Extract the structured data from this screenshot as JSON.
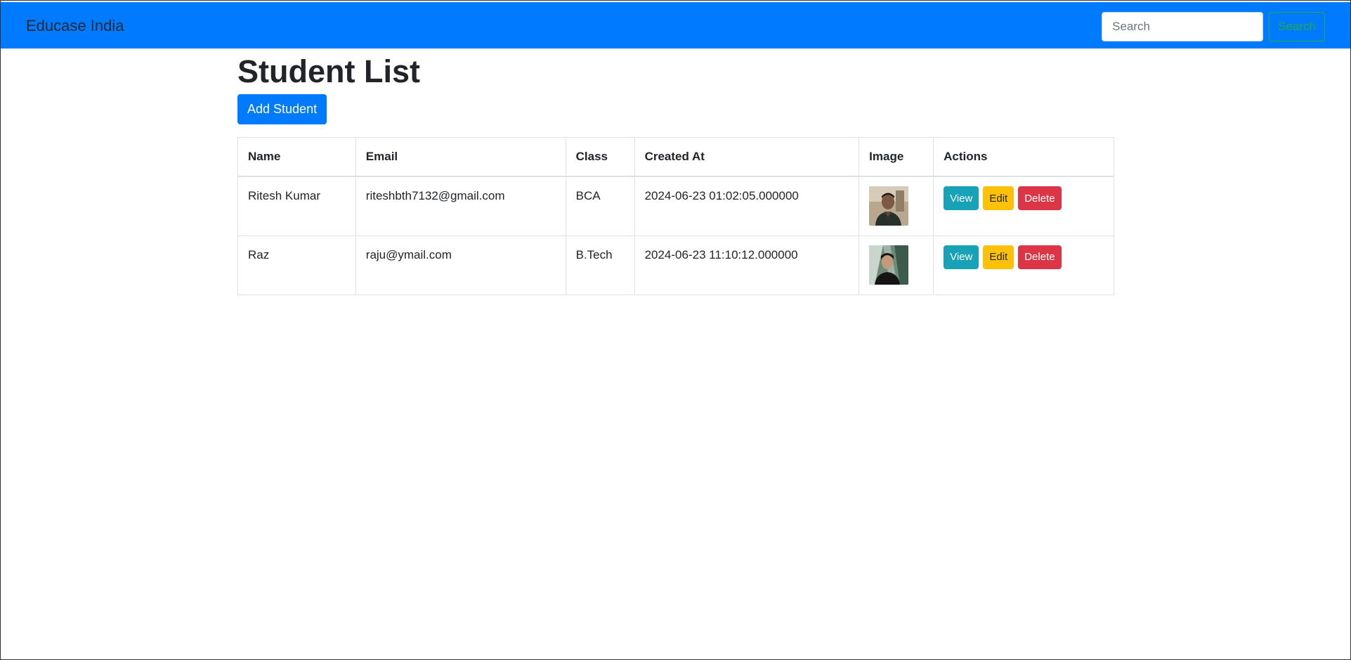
{
  "navbar": {
    "brand": "Educase India",
    "search_placeholder": "Search",
    "search_button": "Search",
    "background": "#007bff"
  },
  "page": {
    "title": "Student List",
    "add_button": "Add Student"
  },
  "table": {
    "headers": [
      "Name",
      "Email",
      "Class",
      "Created At",
      "Image",
      "Actions"
    ],
    "rows": [
      {
        "name": "Ritesh Kumar",
        "email": "riteshbth7132@gmail.com",
        "class": "BCA",
        "created_at": "2024-06-23 01:02:05.000000",
        "image": "student-photo"
      },
      {
        "name": "Raz",
        "email": "raju@ymail.com",
        "class": "B.Tech",
        "created_at": "2024-06-23 11:10:12.000000",
        "image": "student-photo"
      }
    ],
    "actions": {
      "view": "View",
      "edit": "Edit",
      "delete": "Delete"
    }
  },
  "colors": {
    "primary": "#007bff",
    "info": "#17a2b8",
    "warning": "#ffc107",
    "danger": "#dc3545",
    "success": "#28a745"
  }
}
